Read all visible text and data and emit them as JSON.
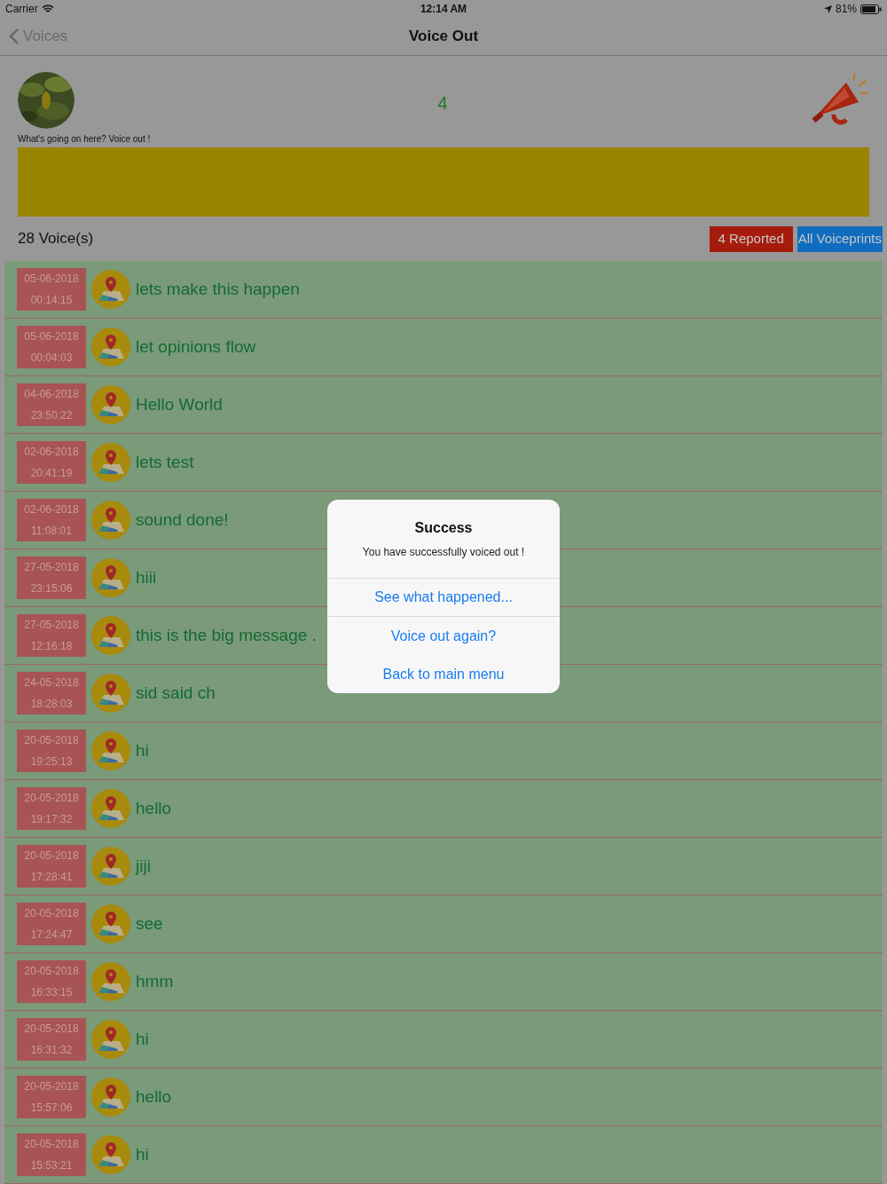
{
  "status_bar": {
    "carrier": "Carrier",
    "time": "12:14 AM",
    "battery": "81%"
  },
  "nav": {
    "back": "Voices",
    "title": "Voice Out"
  },
  "header": {
    "caption": "What's going on here? Voice out !",
    "count": "4"
  },
  "summary": {
    "count": "28 Voice(s)",
    "reported": "4 Reported",
    "all": "All Voiceprints"
  },
  "voices": [
    {
      "date": "05-06-2018",
      "time": "00:14:15",
      "text": "lets make this happen"
    },
    {
      "date": "05-06-2018",
      "time": "00:04:03",
      "text": "let opinions flow"
    },
    {
      "date": "04-06-2018",
      "time": "23:50:22",
      "text": "Hello World"
    },
    {
      "date": "02-06-2018",
      "time": "20:41:19",
      "text": "lets test"
    },
    {
      "date": "02-06-2018",
      "time": "11:08:01",
      "text": "sound done!"
    },
    {
      "date": "27-05-2018",
      "time": "23:15:06",
      "text": "hiii"
    },
    {
      "date": "27-05-2018",
      "time": "12:16:18",
      "text": "this is the big message ."
    },
    {
      "date": "24-05-2018",
      "time": "18:28:03",
      "text": "sid said ch"
    },
    {
      "date": "20-05-2018",
      "time": "19:25:13",
      "text": "hi"
    },
    {
      "date": "20-05-2018",
      "time": "19:17:32",
      "text": "hello"
    },
    {
      "date": "20-05-2018",
      "time": "17:28:41",
      "text": "jiji"
    },
    {
      "date": "20-05-2018",
      "time": "17:24:47",
      "text": "see"
    },
    {
      "date": "20-05-2018",
      "time": "16:33:15",
      "text": "hmm"
    },
    {
      "date": "20-05-2018",
      "time": "16:31:32",
      "text": "hi"
    },
    {
      "date": "20-05-2018",
      "time": "15:57:06",
      "text": "hello"
    },
    {
      "date": "20-05-2018",
      "time": "15:53:21",
      "text": "hi"
    }
  ],
  "alert": {
    "title": "Success",
    "message": "You have successfully voiced out !",
    "actions": [
      "See what happened...",
      "Voice out again?",
      "Back to main menu"
    ]
  }
}
